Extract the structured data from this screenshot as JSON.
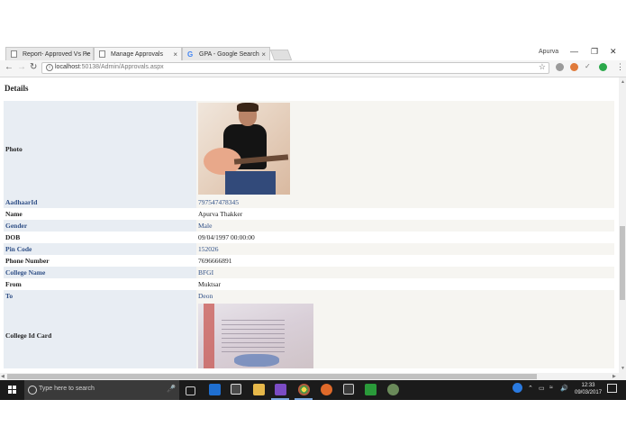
{
  "browser": {
    "tabs": [
      {
        "label": "Report- Approved Vs Pe",
        "icon": "page-icon",
        "active": false
      },
      {
        "label": "Manage Approvals",
        "icon": "page-icon",
        "active": true
      },
      {
        "label": "GPA - Google Search",
        "icon": "google-icon",
        "active": false
      }
    ],
    "user": "Apurva",
    "url_host": "localhost",
    "url_path": ":50138/Admin/Approvals.aspx",
    "close_glyph": "×",
    "google_letter": "G"
  },
  "page": {
    "heading": "Details",
    "rows": [
      {
        "label": "Photo",
        "type": "image"
      },
      {
        "label": "AadhaarId",
        "value": "797547478345"
      },
      {
        "label": "Name",
        "value": "Apurva Thakker"
      },
      {
        "label": "Gender",
        "value": "Male"
      },
      {
        "label": "DOB",
        "value": "09/04/1997 00:00:00"
      },
      {
        "label": "Pin Code",
        "value": "152026"
      },
      {
        "label": "Phone Number",
        "value": "7696666891"
      },
      {
        "label": "College Name",
        "value": "BFGI"
      },
      {
        "label": "From",
        "value": "Muktsar"
      },
      {
        "label": "To",
        "value": "Deon"
      },
      {
        "label": "College Id Card",
        "type": "image"
      }
    ]
  },
  "taskbar": {
    "search_placeholder": "Type here to search",
    "time": "12:33",
    "date": "09/03/2017"
  },
  "colors": {
    "label_bg": "#e8edf3",
    "value_bg": "#f6f5f1",
    "link_blue": "#2f4f86",
    "taskbar": "#1b1b1b"
  }
}
